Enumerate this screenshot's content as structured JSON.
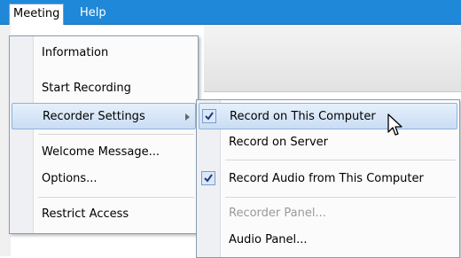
{
  "menubar": {
    "meeting": "Meeting",
    "help": "Help"
  },
  "meeting_menu": {
    "items": [
      {
        "label": "Information"
      },
      {
        "label": "Start Recording"
      },
      {
        "label": "Recorder Settings"
      },
      {
        "label": "Welcome Message..."
      },
      {
        "label": "Options..."
      },
      {
        "label": "Restrict Access"
      }
    ]
  },
  "recorder_menu": {
    "items": [
      {
        "label": "Record on This Computer",
        "checked": true
      },
      {
        "label": "Record on Server",
        "checked": false
      },
      {
        "label": "Record Audio from This Computer",
        "checked": true
      },
      {
        "label": "Recorder Panel...",
        "disabled": true
      },
      {
        "label": "Audio Panel..."
      }
    ]
  }
}
